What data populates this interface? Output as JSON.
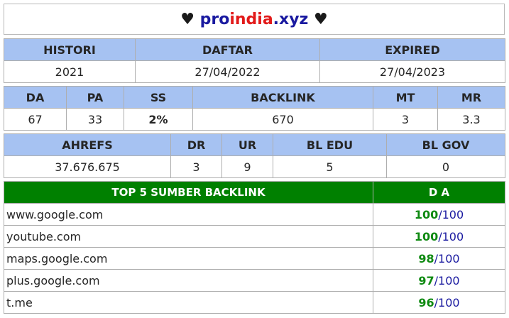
{
  "header": {
    "heart_left": "♥",
    "domain_part1": "pro",
    "domain_part2": "india",
    "domain_part3": ".xyz",
    "heart_right": "♥"
  },
  "table1": {
    "headers": [
      "HISTORI",
      "DAFTAR",
      "EXPIRED"
    ],
    "values": [
      "2021",
      "27/04/2022",
      "27/04/2023"
    ]
  },
  "table2": {
    "headers": [
      "DA",
      "PA",
      "SS",
      "BACKLINK",
      "MT",
      "MR"
    ],
    "values": [
      "67",
      "33",
      "2%",
      "670",
      "3",
      "3.3"
    ]
  },
  "table3": {
    "headers": [
      "AHREFS",
      "DR",
      "UR",
      "BL EDU",
      "BL GOV"
    ],
    "values": [
      "37.676.675",
      "3",
      "9",
      "5",
      "0"
    ]
  },
  "top5": {
    "title": "TOP 5 SUMBER BACKLINK",
    "da_header": "D A",
    "separator": "/",
    "rows": [
      {
        "site": "www.google.com",
        "da": "100",
        "max": "100"
      },
      {
        "site": "youtube.com",
        "da": "100",
        "max": "100"
      },
      {
        "site": "maps.google.com",
        "da": "98",
        "max": "100"
      },
      {
        "site": "plus.google.com",
        "da": "97",
        "max": "100"
      },
      {
        "site": "t.me",
        "da": "96",
        "max": "100"
      }
    ]
  },
  "colors": {
    "header_bg": "#a6c2f2",
    "top5_header_bg": "#008000",
    "green_value": "#0f8a12",
    "blue_text": "#1a1aa0",
    "red_text": "#e21a1a"
  }
}
